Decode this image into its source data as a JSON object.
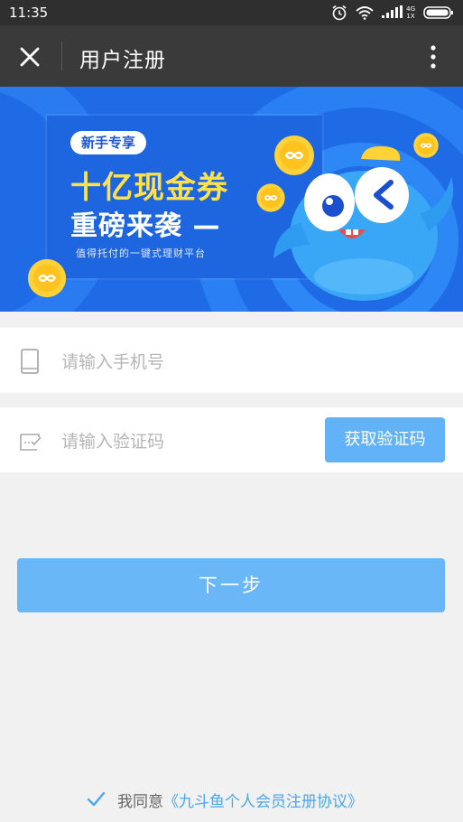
{
  "status_bar": {
    "time": "11:35",
    "network": "4G\n1X"
  },
  "nav": {
    "title": "用户注册"
  },
  "banner": {
    "tag": "新手专享",
    "headline1": "十亿现金券",
    "headline2": "重磅来袭 —",
    "subtitle": "值得托付的一键式理财平台"
  },
  "form": {
    "phone_placeholder": "请输入手机号",
    "code_placeholder": "请输入验证码",
    "get_code_label": "获取验证码",
    "next_label": "下一步"
  },
  "agreement": {
    "prefix": "我同意",
    "link": "《九斗鱼个人会员注册协议》",
    "checked": true
  },
  "colors": {
    "accent": "#62b2f7",
    "banner_blue": "#1f6be6",
    "headline_yellow": "#ffe14d",
    "link": "#4aa7f1"
  }
}
